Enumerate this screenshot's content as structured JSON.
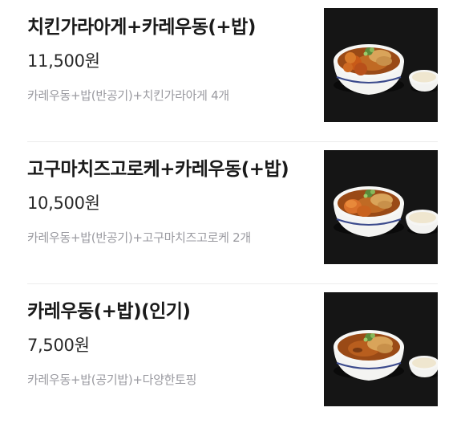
{
  "menu": {
    "items": [
      {
        "name": "치킨가라아게+카레우동(+밥)",
        "price": "11,500원",
        "description": "카레우동+밥(반공기)+치킨가라아게 4개",
        "image_icon": "curry-udon-karaage-photo"
      },
      {
        "name": "고구마치즈고로케+카레우동(+밥)",
        "price": "10,500원",
        "description": "카레우동+밥(반공기)+고구마치즈고로케 2개",
        "image_icon": "curry-udon-croquette-photo"
      },
      {
        "name": "카레우동(+밥)(인기)",
        "price": "7,500원",
        "description": "카레우동+밥(공기밥)+다양한토핑",
        "image_icon": "curry-udon-photo"
      }
    ]
  },
  "colors": {
    "name": "#1a1a1a",
    "price": "#2a2a2a",
    "description": "#9a9aa0",
    "divider": "#ececec",
    "photo_background": "#151515"
  }
}
